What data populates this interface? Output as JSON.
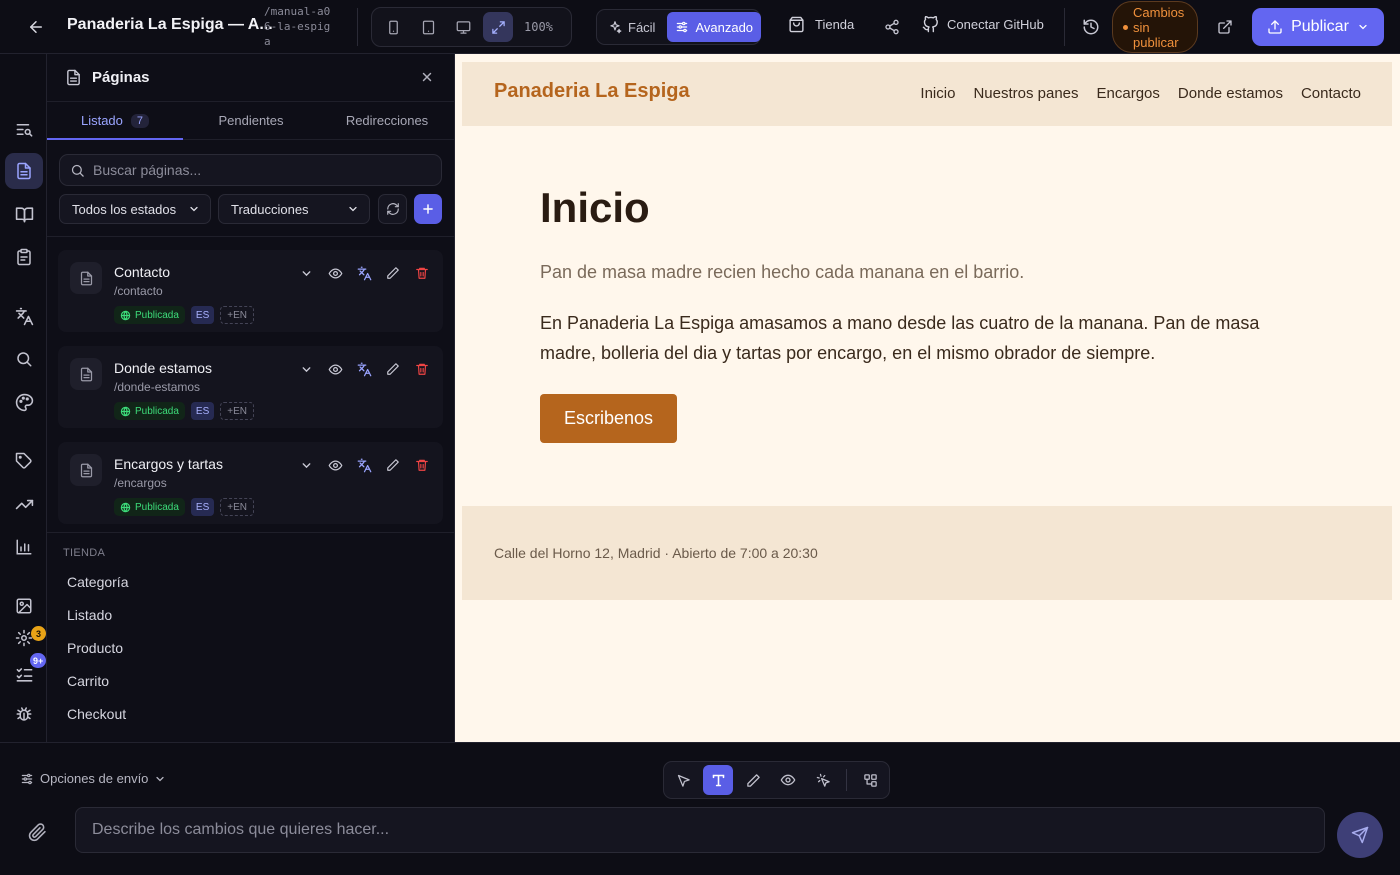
{
  "topbar": {
    "back_label": "Volver",
    "project_title": "Panaderia La Espiga — A...",
    "project_slug": "/manual-a06-la-espiga",
    "zoom": "100%",
    "mode_easy": "Fácil",
    "mode_advanced": "Avanzado",
    "store_label": "Tienda",
    "github_label": "Conectar GitHub",
    "unpublished_label": "Cambios sin publicar",
    "publish_label": "Publicar"
  },
  "rail": {
    "badge_count_a": "3",
    "badge_count_b": "9+"
  },
  "panel": {
    "title": "Páginas",
    "tabs": [
      {
        "label": "Listado",
        "count": "7"
      },
      {
        "label": "Pendientes"
      },
      {
        "label": "Redirecciones"
      }
    ],
    "search_placeholder": "Buscar páginas...",
    "status_filter": "Todos los estados",
    "translation_filter": "Traducciones",
    "pages": [
      {
        "title": "Contacto",
        "path": "/contacto",
        "status": "Publicada",
        "lang": "ES",
        "lang_add": "+EN"
      },
      {
        "title": "Donde estamos",
        "path": "/donde-estamos",
        "status": "Publicada",
        "lang": "ES",
        "lang_add": "+EN"
      },
      {
        "title": "Encargos y tartas",
        "path": "/encargos",
        "status": "Publicada",
        "lang": "ES",
        "lang_add": "+EN"
      }
    ],
    "shop_section": "TIENDA",
    "shop_items": [
      "Categoría",
      "Listado",
      "Producto",
      "Carrito",
      "Checkout"
    ]
  },
  "preview": {
    "logo": "Panaderia La Espiga",
    "nav": [
      "Inicio",
      "Nuestros panes",
      "Encargos",
      "Donde estamos",
      "Contacto"
    ],
    "hero_title": "Inicio",
    "hero_subtitle": "Pan de masa madre recien hecho cada manana en el barrio.",
    "hero_body": "En Panaderia La Espiga amasamos a mano desde las cuatro de la manana. Pan de masa madre, bolleria del dia y tartas por encargo, en el mismo obrador de siempre.",
    "cta_label": "Escribenos",
    "footer": "Calle del Horno 12, Madrid · Abierto de 7:00 a 20:30"
  },
  "composer": {
    "send_options": "Opciones de envío",
    "prompt_placeholder": "Describe los cambios que quieres hacer..."
  },
  "colors": {
    "accent": "#6366f1",
    "brand": "#b5651d",
    "warning": "#f0913c",
    "published": "#3ddc7a",
    "danger": "#ef4444"
  }
}
